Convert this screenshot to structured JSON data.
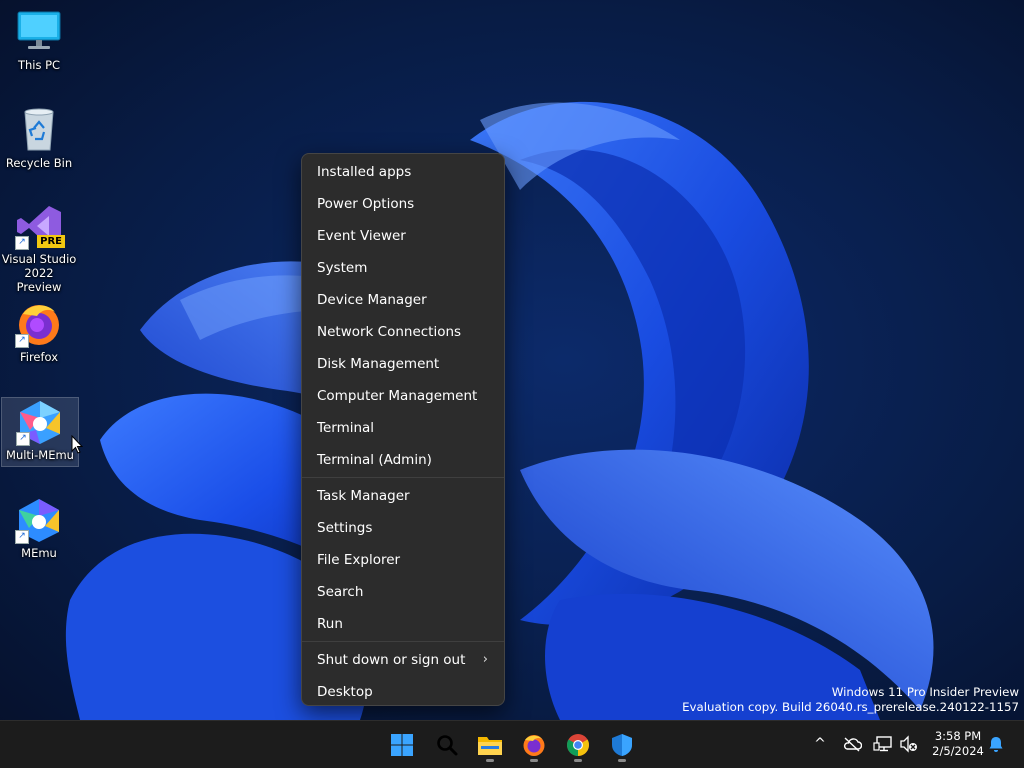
{
  "desktop": {
    "icons": [
      {
        "label": "This PC"
      },
      {
        "label": "Recycle Bin"
      },
      {
        "label": "Visual Studio 2022 Preview",
        "badge": "PRE"
      },
      {
        "label": "Firefox"
      },
      {
        "label": "Multi-MEmu"
      },
      {
        "label": "MEmu"
      }
    ]
  },
  "context_menu": {
    "group1": [
      "Installed apps",
      "Power Options",
      "Event Viewer",
      "System",
      "Device Manager",
      "Network Connections",
      "Disk Management",
      "Computer Management",
      "Terminal",
      "Terminal (Admin)"
    ],
    "group2": [
      "Task Manager",
      "Settings",
      "File Explorer",
      "Search",
      "Run"
    ],
    "group3": [
      "Shut down or sign out",
      "Desktop"
    ],
    "submenu_chevron": "›"
  },
  "watermark": {
    "line1": "Windows 11 Pro Insider Preview",
    "line2": "Evaluation copy. Build 26040.rs_prerelease.240122-1157"
  },
  "taskbar": {
    "apps": [
      {
        "icon": "windows-start-icon"
      },
      {
        "icon": "search-icon"
      },
      {
        "icon": "file-explorer-icon"
      },
      {
        "icon": "firefox-icon"
      },
      {
        "icon": "chrome-icon"
      },
      {
        "icon": "windows-security-icon"
      }
    ],
    "tray": {
      "chevron": "^",
      "time": "3:58 PM",
      "date": "2/5/2024"
    }
  },
  "colors": {
    "menu_bg": "#2c2c2c",
    "taskbar_bg": "#1c1c1c",
    "accent_blue": "#1e5bff"
  }
}
